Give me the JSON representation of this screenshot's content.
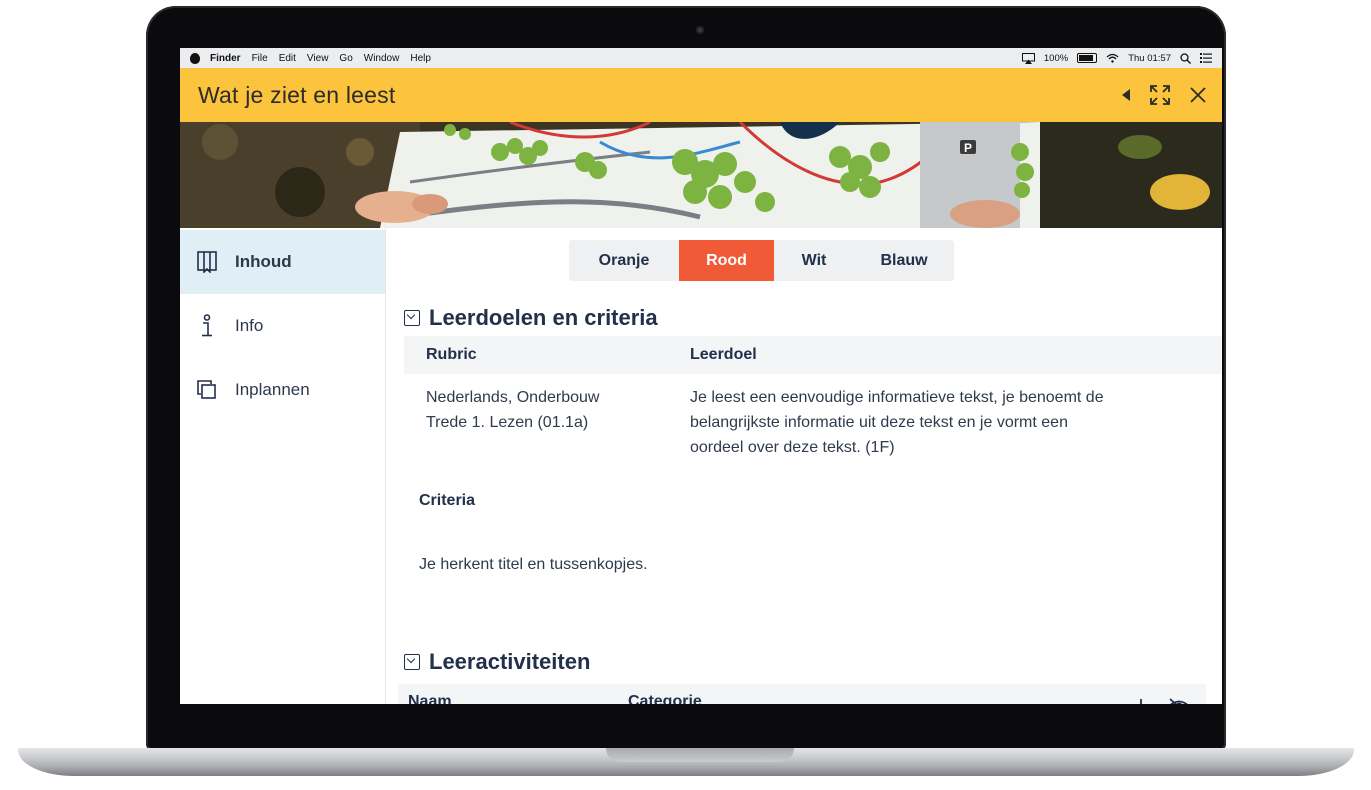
{
  "menubar": {
    "items": [
      "Finder",
      "File",
      "Edit",
      "View",
      "Go",
      "Window",
      "Help"
    ],
    "battery": "100%",
    "clock": "Thu 01:57"
  },
  "window": {
    "title": "Wat je ziet en leest"
  },
  "sidebar": {
    "items": [
      {
        "label": "Inhoud",
        "icon": "book-icon",
        "active": true
      },
      {
        "label": "Info",
        "icon": "info-icon",
        "active": false
      },
      {
        "label": "Inplannen",
        "icon": "copy-icon",
        "active": false
      }
    ]
  },
  "tabs": [
    {
      "label": "Oranje",
      "active": false
    },
    {
      "label": "Rood",
      "active": true
    },
    {
      "label": "Wit",
      "active": false
    },
    {
      "label": "Blauw",
      "active": false
    }
  ],
  "leerdoelen": {
    "heading": "Leerdoelen en criteria",
    "columns": {
      "rubric": "Rubric",
      "leerdoel": "Leerdoel"
    },
    "row": {
      "rubric_lines": [
        "Nederlands, Onderbouw",
        "Trede 1. Lezen (01.1a)"
      ],
      "leerdoel_lines": [
        "Je leest een eenvoudige informatieve tekst, je benoemt de",
        "belangrijkste informatie uit deze tekst en je vormt een",
        "oordeel over deze tekst. (1F)"
      ]
    },
    "criteria_heading": "Criteria",
    "criteria_text": "Je herkent titel en tussenkopjes."
  },
  "leeractiviteiten": {
    "heading": "Leeractiviteiten",
    "columns": {
      "naam": "Naam",
      "categorie": "Categorie"
    }
  },
  "colors": {
    "titlebar": "#fcc43c",
    "active_tab": "#f15a36",
    "sidebar_active": "#e0eef6",
    "text_dark": "#22304a"
  }
}
